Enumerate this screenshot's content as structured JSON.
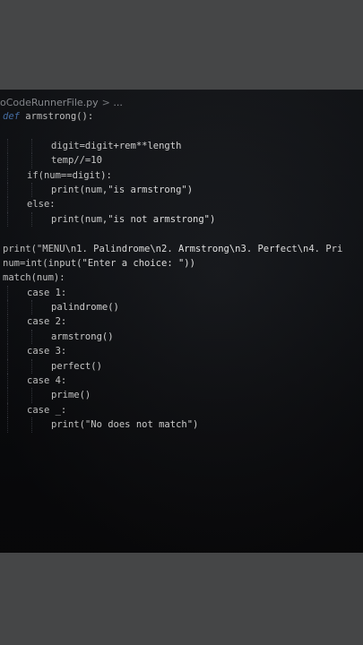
{
  "breadcrumb": {
    "file": "oCodeRunnerFile.py",
    "arrow": ">",
    "ellipsis": "..."
  },
  "code_lines": [
    {
      "indent": 0,
      "tokens": [
        {
          "t": "def",
          "c": "kw-def"
        },
        {
          "t": " armstrong():",
          "c": "plain"
        }
      ]
    },
    {
      "indent": 0,
      "tokens": [
        {
          "t": "",
          "c": "plain"
        }
      ]
    },
    {
      "indent": 2,
      "tokens": [
        {
          "t": "digit=digit+rem**length",
          "c": "plain"
        }
      ]
    },
    {
      "indent": 2,
      "tokens": [
        {
          "t": "temp//=10",
          "c": "plain"
        }
      ]
    },
    {
      "indent": 1,
      "tokens": [
        {
          "t": "if(num==digit):",
          "c": "plain"
        }
      ]
    },
    {
      "indent": 2,
      "tokens": [
        {
          "t": "print(num,\"is armstrong\")",
          "c": "plain"
        }
      ]
    },
    {
      "indent": 1,
      "tokens": [
        {
          "t": "else:",
          "c": "plain"
        }
      ]
    },
    {
      "indent": 2,
      "tokens": [
        {
          "t": "print(num,\"is not armstrong\")",
          "c": "plain"
        }
      ]
    },
    {
      "indent": 0,
      "tokens": [
        {
          "t": "",
          "c": "plain"
        }
      ]
    },
    {
      "indent": 0,
      "tokens": [
        {
          "t": "print(\"MENU\\n1. Palindrome\\n2. Armstrong\\n3. Perfect\\n4. Pri",
          "c": "plain"
        }
      ]
    },
    {
      "indent": 0,
      "tokens": [
        {
          "t": "num=int(input(\"Enter a choice: \"))",
          "c": "plain"
        }
      ]
    },
    {
      "indent": 0,
      "tokens": [
        {
          "t": "match(num):",
          "c": "plain"
        }
      ]
    },
    {
      "indent": 1,
      "tokens": [
        {
          "t": "case 1:",
          "c": "plain"
        }
      ]
    },
    {
      "indent": 2,
      "tokens": [
        {
          "t": "palindrome()",
          "c": "plain"
        }
      ]
    },
    {
      "indent": 1,
      "tokens": [
        {
          "t": "case 2:",
          "c": "plain"
        }
      ]
    },
    {
      "indent": 2,
      "tokens": [
        {
          "t": "armstrong()",
          "c": "plain"
        }
      ]
    },
    {
      "indent": 1,
      "tokens": [
        {
          "t": "case 3:",
          "c": "plain"
        }
      ]
    },
    {
      "indent": 2,
      "tokens": [
        {
          "t": "perfect()",
          "c": "plain"
        }
      ]
    },
    {
      "indent": 1,
      "tokens": [
        {
          "t": "case 4:",
          "c": "plain"
        }
      ]
    },
    {
      "indent": 2,
      "tokens": [
        {
          "t": "prime()",
          "c": "plain"
        }
      ]
    },
    {
      "indent": 1,
      "tokens": [
        {
          "t": "case _:",
          "c": "plain"
        }
      ]
    },
    {
      "indent": 2,
      "tokens": [
        {
          "t": "print(\"No does not match\")",
          "c": "plain"
        }
      ]
    }
  ],
  "colors": {
    "editor_bg": "#101216",
    "frame_bg": "#454647",
    "keyword_def": "#5b8fd6",
    "text": "#eaeaea"
  }
}
